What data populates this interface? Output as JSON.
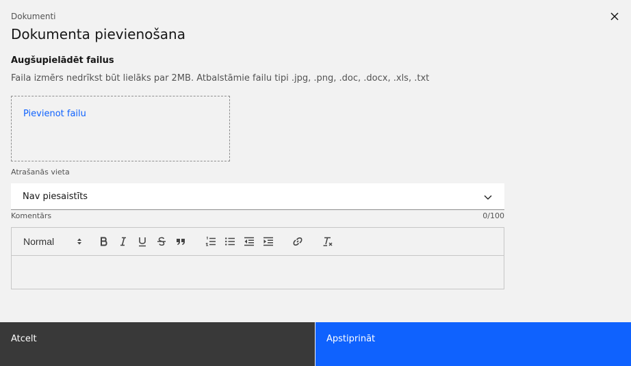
{
  "modal": {
    "eyebrow": "Dokumenti",
    "title": "Dokumenta pievienošana",
    "close_icon": "close-icon"
  },
  "upload": {
    "title": "Augšupielādēt failus",
    "description": "Faila izmērs nedrīkst būt lielāks par 2MB. Atbalstāmie failu tipi .jpg, .png, .doc, .docx, .xls, .txt",
    "add_file_link": "Pievienot failu"
  },
  "location": {
    "label": "Atrašanās vieta",
    "value": "Nav piesaistīts",
    "chevron_icon": "chevron-down-icon"
  },
  "comment": {
    "label": "Komentārs",
    "counter": "0/100",
    "format_value": "Normal",
    "toolbar_icons": [
      "bold-icon",
      "italic-icon",
      "underline-icon",
      "strikethrough-icon",
      "blockquote-icon",
      "ordered-list-icon",
      "bullet-list-icon",
      "outdent-icon",
      "indent-icon",
      "link-icon",
      "clear-format-icon"
    ]
  },
  "footer": {
    "cancel_label": "Atcelt",
    "confirm_label": "Apstiprināt"
  },
  "colors": {
    "primary": "#0f62fe",
    "secondary": "#393939",
    "background": "#f2f2f2"
  }
}
